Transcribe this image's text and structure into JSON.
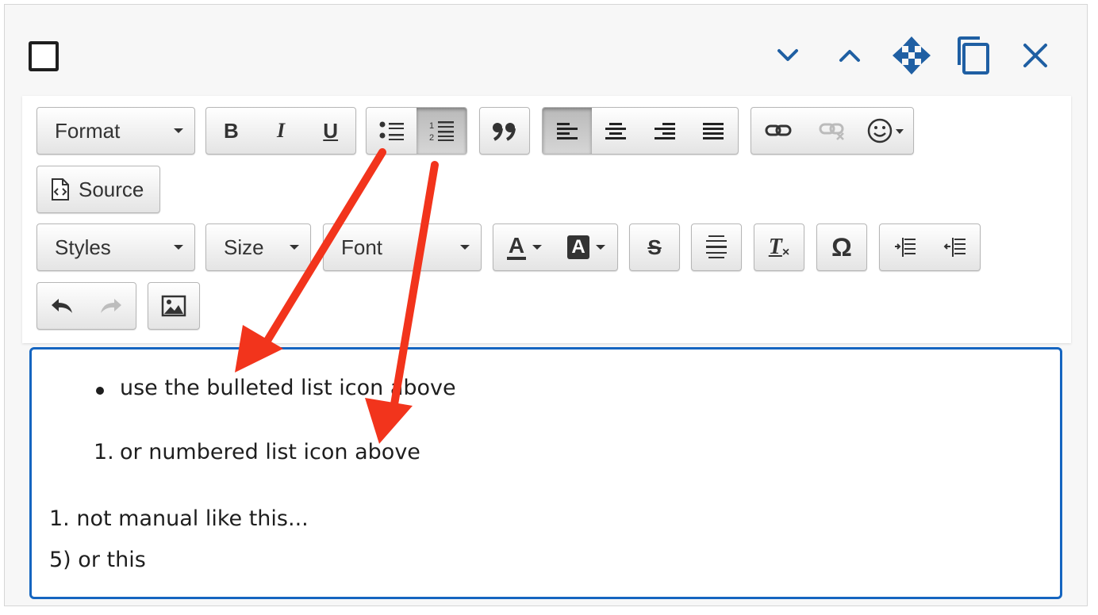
{
  "window": {
    "controls": [
      "chevron-down-icon",
      "chevron-up-icon",
      "move-icon",
      "copy-icon",
      "close-icon"
    ],
    "accent_color": "#1f5fa3"
  },
  "toolbar": {
    "format_label": "Format",
    "source_label": "Source",
    "styles_label": "Styles",
    "size_label": "Size",
    "font_label": "Font",
    "bold_label": "B",
    "italic_label": "I",
    "underline_label": "U",
    "strike_label": "S",
    "omega_label": "Ω",
    "text_color_label": "A",
    "bg_color_label": "A",
    "clear_format_label": "T"
  },
  "content": {
    "bulleted_item": "use the bulleted list icon above",
    "numbered_marker": "1.",
    "numbered_item": "or numbered list icon above",
    "manual_line_1": "1. not manual like this...",
    "manual_line_2": "5) or this"
  },
  "annotation": {
    "arrow_color": "#f2341c"
  },
  "editor_border_color": "#1565c0"
}
